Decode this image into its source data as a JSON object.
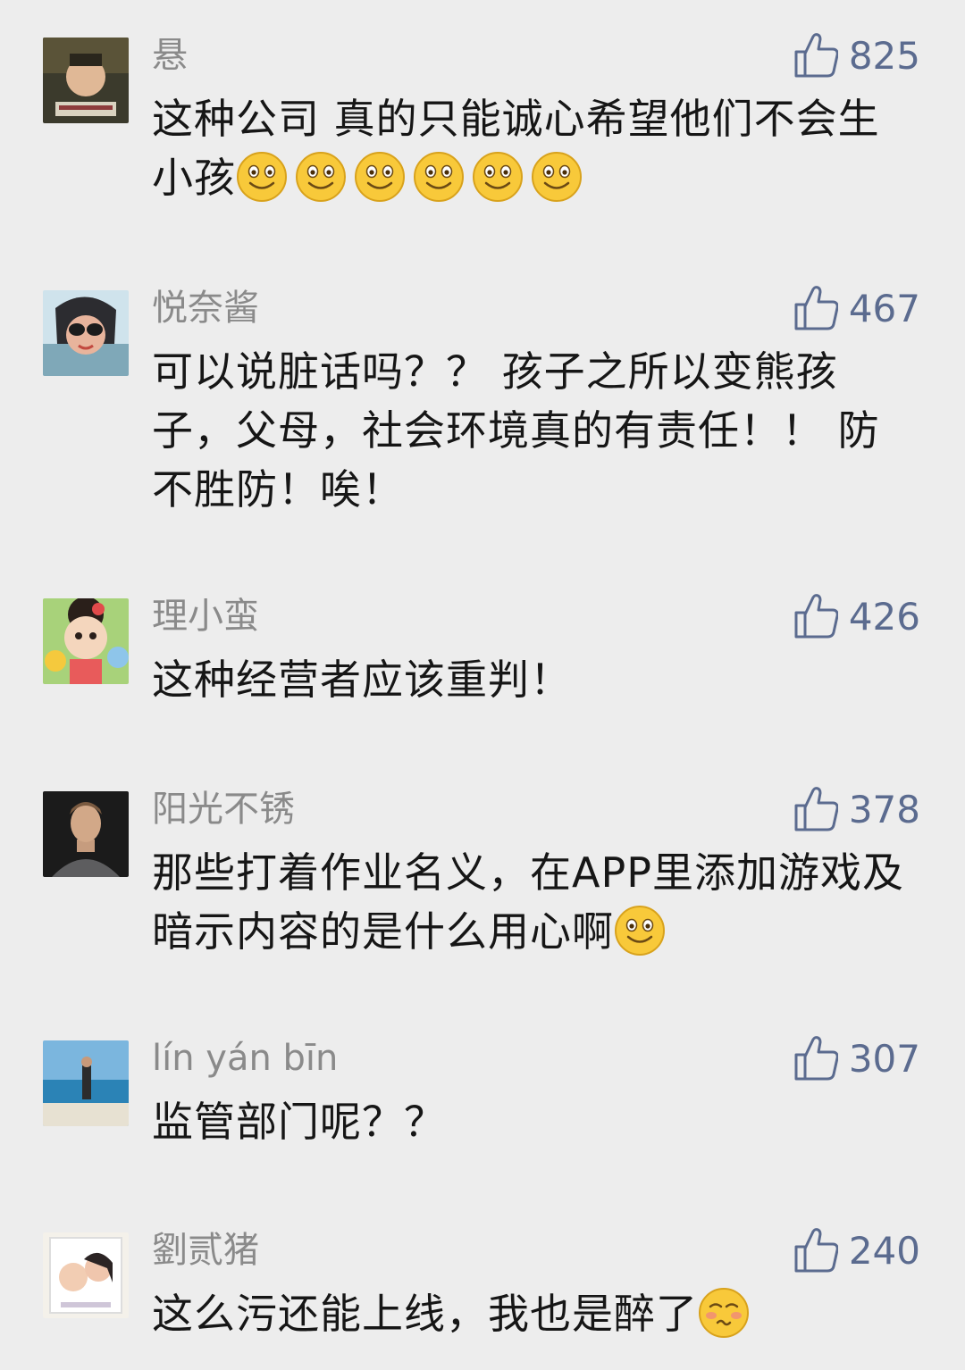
{
  "comments": [
    {
      "nickname": "悬",
      "likes": "825",
      "text": "这种公司 真的只能诚心希望他们不会生小孩",
      "emoji": "smile-emoji",
      "emoji_count": 6
    },
    {
      "nickname": "悦奈酱",
      "likes": "467",
      "text": "可以说脏话吗？？ 孩子之所以变熊孩子，父母，社会环境真的有责任！！ 防不胜防！唉！"
    },
    {
      "nickname": "理小蛮",
      "likes": "426",
      "text": "这种经营者应该重判！"
    },
    {
      "nickname": "阳光不锈",
      "likes": "378",
      "text": "那些打着作业名义，在APP里添加游戏及暗示内容的是什么用心啊",
      "emoji": "smile-emoji",
      "emoji_count": 1
    },
    {
      "nickname": "lín yán bīn",
      "likes": "307",
      "text": "监管部门呢？？"
    },
    {
      "nickname": "劉贰猪",
      "likes": "240",
      "text": "这么污还能上线，我也是醉了",
      "emoji": "tipsy-emoji",
      "emoji_count": 1
    }
  ],
  "icons": {
    "like": "thumbs-up-icon"
  },
  "colors": {
    "background": "#ededed",
    "nickname": "#8a8a8a",
    "like": "#5b6b8f",
    "text": "#161616"
  }
}
